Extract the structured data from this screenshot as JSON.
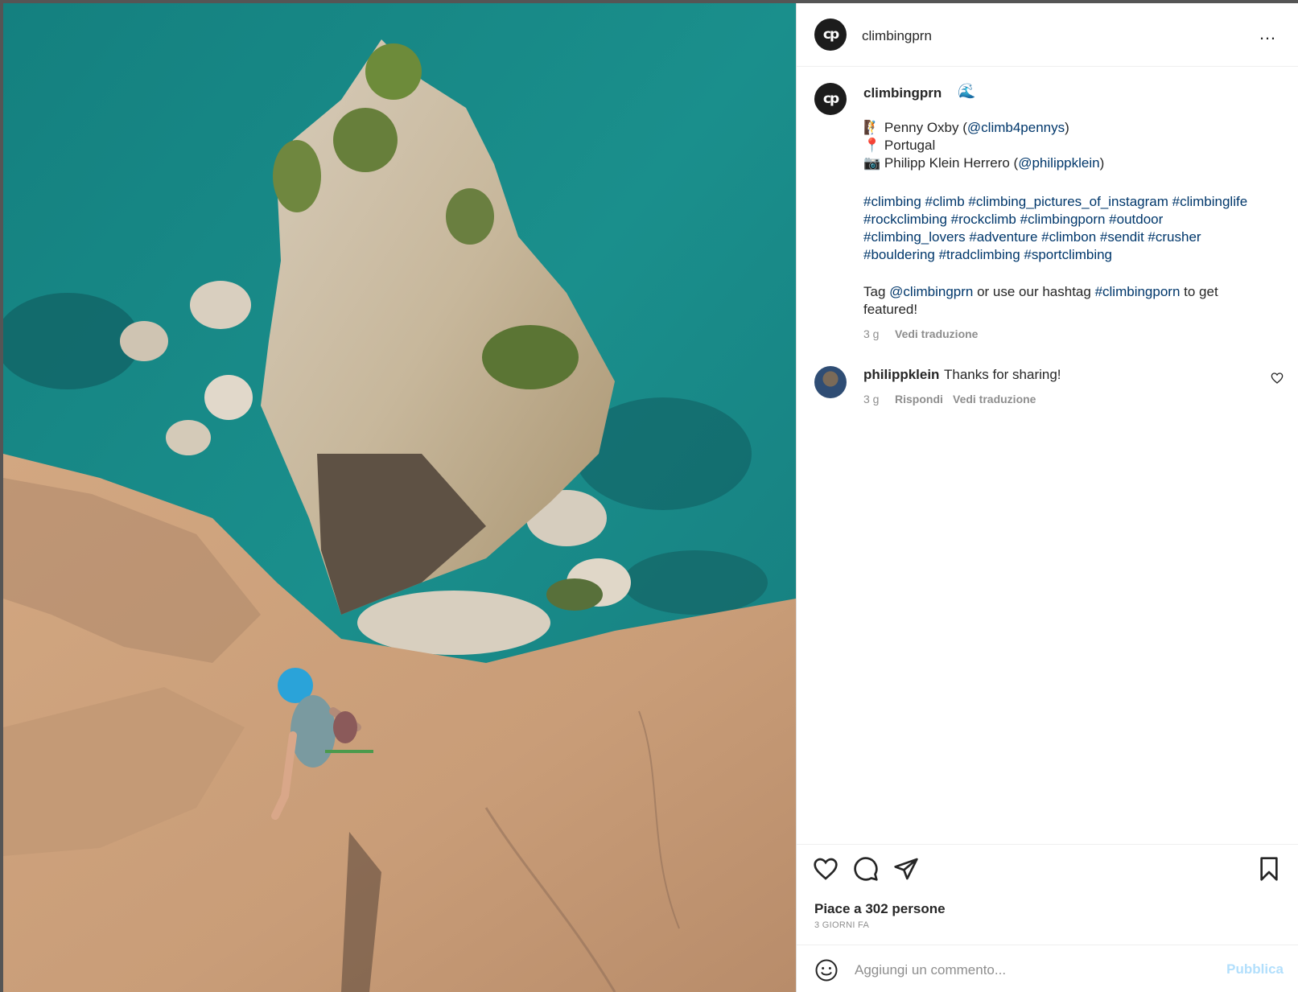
{
  "post": {
    "username": "climbingprn",
    "avatar_text": "cp",
    "more_icon": "…",
    "wave_emoji": "🌊"
  },
  "caption": {
    "line1_emoji": "🧗",
    "line1_name": "Penny Oxby",
    "line1_open": "(",
    "line1_handle": "@climb4pennys",
    "line1_close": ")",
    "line2_emoji": "📍",
    "line2_text": "Portugal",
    "line3_emoji": "📷",
    "line3_name": "Philipp Klein Herrero",
    "line3_open": "(",
    "line3_handle": "@philippklein",
    "line3_close": ")",
    "hashtags_line1": "#climbing #climb #climbing_pictures_of_instagram #climbinglife",
    "hashtags_line2": "#rockclimbing #rockclimb #climbingporn #outdoor",
    "hashtags_line3": "#climbing_lovers #adventure #climbon #sendit #crusher",
    "hashtags_line4": "#bouldering #tradclimbing #sportclimbing",
    "tag_prefix": "Tag",
    "tag_handle": "@climbingprn",
    "tag_middle": "or use our hashtag",
    "tag_hashtag": "#climbingporn",
    "tag_suffix": "to get",
    "tag_line2": "featured!",
    "time": "3 g",
    "translate": "Vedi traduzione"
  },
  "comment": {
    "username": "philippklein",
    "text": "Thanks for sharing!",
    "time": "3 g",
    "reply": "Rispondi",
    "translate": "Vedi traduzione"
  },
  "footer": {
    "likes": "Piace a 302 persone",
    "date": "3 GIORNI FA",
    "comment_placeholder": "Aggiungi un commento...",
    "publish": "Pubblica"
  },
  "colors": {
    "link": "#00376b",
    "meta": "#8e8e8e",
    "publish_disabled": "#b2dffc"
  },
  "icons": [
    "like-icon",
    "comment-icon",
    "share-icon",
    "save-icon",
    "emoji-icon",
    "more-icon",
    "heart-small-icon"
  ]
}
